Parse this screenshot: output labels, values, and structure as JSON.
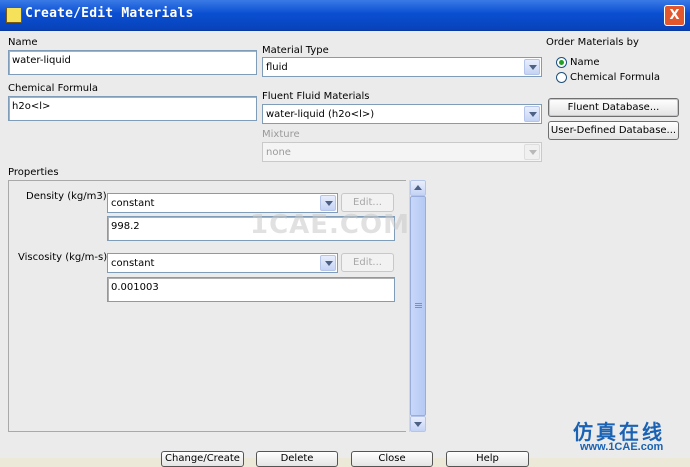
{
  "window": {
    "title": "Create/Edit Materials",
    "close_glyph": "X"
  },
  "name_section": {
    "label": "Name",
    "value": "water-liquid"
  },
  "formula_section": {
    "label": "Chemical Formula",
    "value": "h2o<l>"
  },
  "material_type": {
    "label": "Material Type",
    "selected": "fluid"
  },
  "fluent_fluid_materials": {
    "label": "Fluent Fluid Materials",
    "selected": "water-liquid (h2o<l>)"
  },
  "mixture": {
    "label": "Mixture",
    "selected": "none"
  },
  "order_by": {
    "label": "Order Materials by",
    "options": [
      {
        "label": "Name",
        "checked": true
      },
      {
        "label": "Chemical Formula",
        "checked": false
      }
    ]
  },
  "database_buttons": {
    "fluent": "Fluent Database...",
    "user_defined": "User-Defined Database..."
  },
  "properties": {
    "label": "Properties",
    "rows": [
      {
        "label": "Density (kg/m3)",
        "method": "constant",
        "edit": "Edit...",
        "value": "998.2"
      },
      {
        "label": "Viscosity (kg/m-s)",
        "method": "constant",
        "edit": "Edit...",
        "value": "0.001003"
      }
    ]
  },
  "footer_buttons": [
    "Change/Create",
    "Delete",
    "Close",
    "Help"
  ],
  "watermark": {
    "text": "1CAE.COM",
    "brand_cn": "仿真在线",
    "brand_url": "www.1CAE.com"
  },
  "colors": {
    "title_bar": "#0a4fd2",
    "panel_bg": "#ebebeb",
    "radio_dot": "#21a121",
    "brand": "#1a62b3"
  }
}
